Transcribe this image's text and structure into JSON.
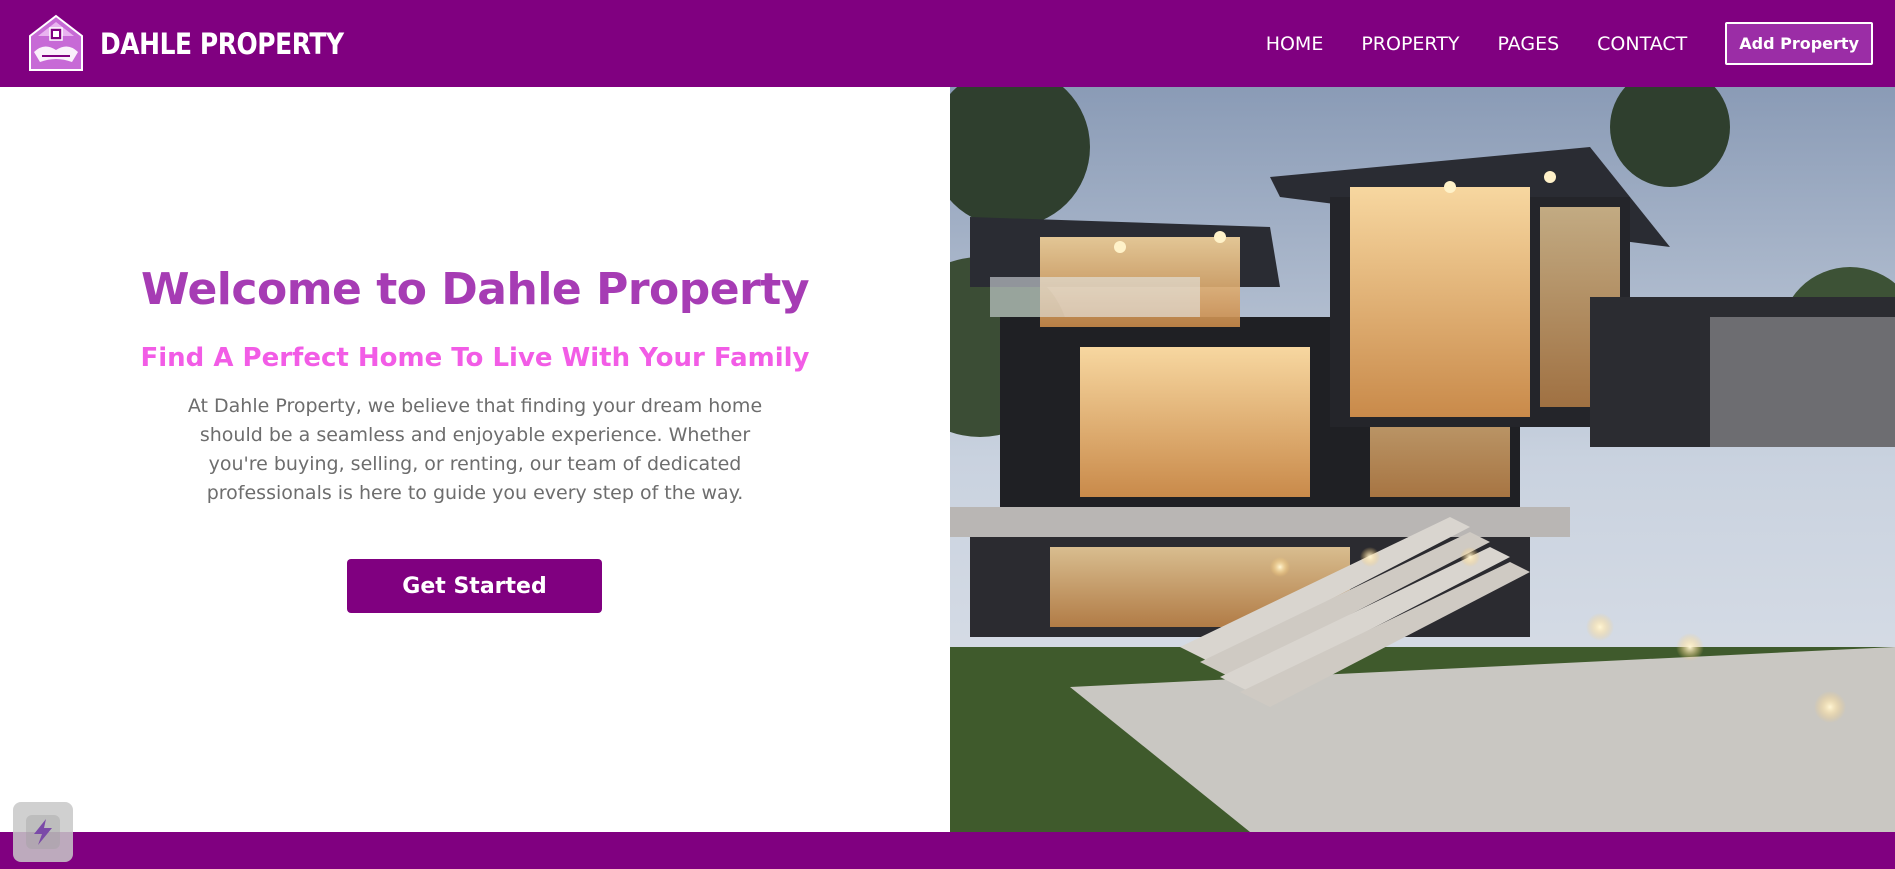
{
  "brand": {
    "name": "DAHLE PROPERTY",
    "logo_icon": "handshake-house-icon"
  },
  "nav": {
    "items": [
      {
        "label": "HOME"
      },
      {
        "label": "PROPERTY"
      },
      {
        "label": "PAGES"
      },
      {
        "label": "CONTACT"
      }
    ],
    "cta_label": "Add Property"
  },
  "hero": {
    "title": "Welcome to Dahle Property",
    "subtitle": "Find A Perfect Home To Live With Your Family",
    "description_lines": [
      "At Dahle Property, we believe that finding your dream home",
      "should be a seamless and enjoyable experience. Whether",
      "you're buying, selling, or renting, our team of dedicated",
      "professionals is here to guide you every step of the way."
    ],
    "cta_label": "Get Started",
    "image_icon": "modern-house-photo"
  },
  "widget": {
    "icon": "lightning-icon"
  },
  "colors": {
    "brand_purple": "#800080",
    "title_purple": "#a63cb4",
    "subtitle_pink": "#f25ce6",
    "text_gray": "#6d6d6d"
  }
}
